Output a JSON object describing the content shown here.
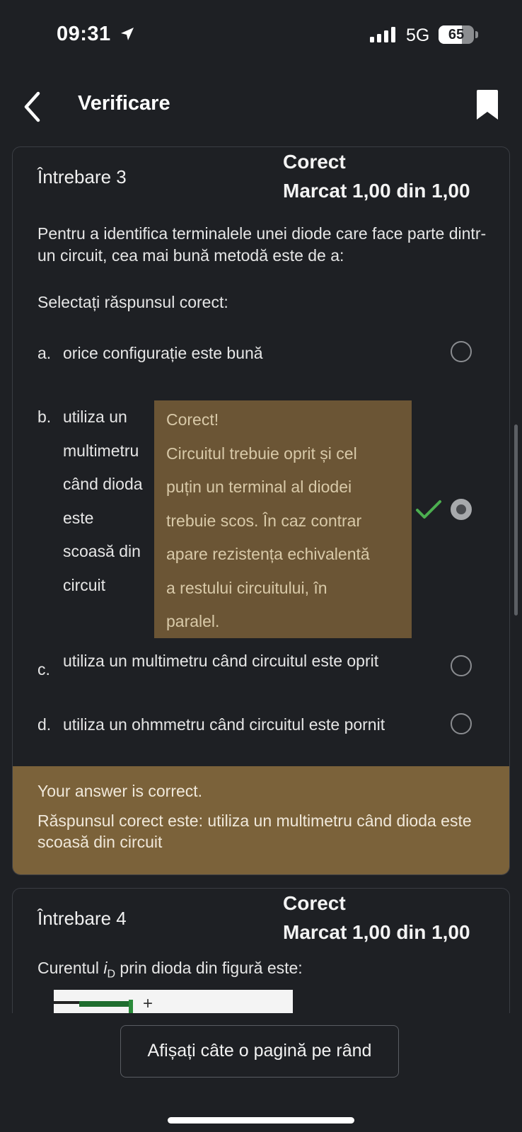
{
  "status_bar": {
    "time": "09:31",
    "network": "5G",
    "battery": "65",
    "battery_level": 0.65,
    "icons": [
      "location-arrow-icon",
      "signal-bars-icon"
    ]
  },
  "header": {
    "title": "Verificare",
    "back_icon": "chevron-left-icon",
    "bookmark_icon": "bookmark-icon"
  },
  "question3": {
    "label": "Întrebare 3",
    "state": "Corect",
    "mark": "Marcat 1,00 din 1,00",
    "text": " Pentru a identifica terminalele unei diode care face parte dintr-un circuit, cea mai bună metodă este de a:",
    "prompt": "Selectați răspunsul corect:",
    "options": [
      {
        "letter": "a.",
        "text": "orice configurație este bună",
        "selected": false
      },
      {
        "letter": "b.",
        "lines": [
          "utiliza un",
          "multimetru",
          "când dioda",
          "este",
          "scoasă din",
          "circuit"
        ],
        "selected": true,
        "correct": true
      },
      {
        "letter": "c.",
        "text": "utiliza un multimetru când circuitul este oprit",
        "selected": false
      },
      {
        "letter": "d.",
        "text": "utiliza un ohmmetru când circuitul este pornit",
        "selected": false
      }
    ],
    "specific_feedback": [
      "Corect!",
      "Circuitul trebuie oprit și cel",
      "puțin un terminal al diodei",
      "trebuie scos. În caz contrar",
      "apare rezistența echivalentă",
      "a restului circuitului, în",
      "paralel."
    ],
    "feedback_line1": "Your answer is correct.",
    "feedback_line2": "Răspunsul corect este: utiliza un multimetru când dioda este scoasă din circuit"
  },
  "question4": {
    "label": "Întrebare 4",
    "state": "Corect",
    "mark": "Marcat 1,00 din 1,00",
    "text_before": "Curentul ",
    "var": "i",
    "sub": "D",
    "text_after": " prin dioda din figură este:",
    "figure_symbol": "+"
  },
  "footer": {
    "button": "Afișați câte o pagină pe rând"
  },
  "colors": {
    "background": "#1e2024",
    "feedback_bg": "#7b623a",
    "tooltip_bg": "#6b5535",
    "check": "#4caf50"
  }
}
